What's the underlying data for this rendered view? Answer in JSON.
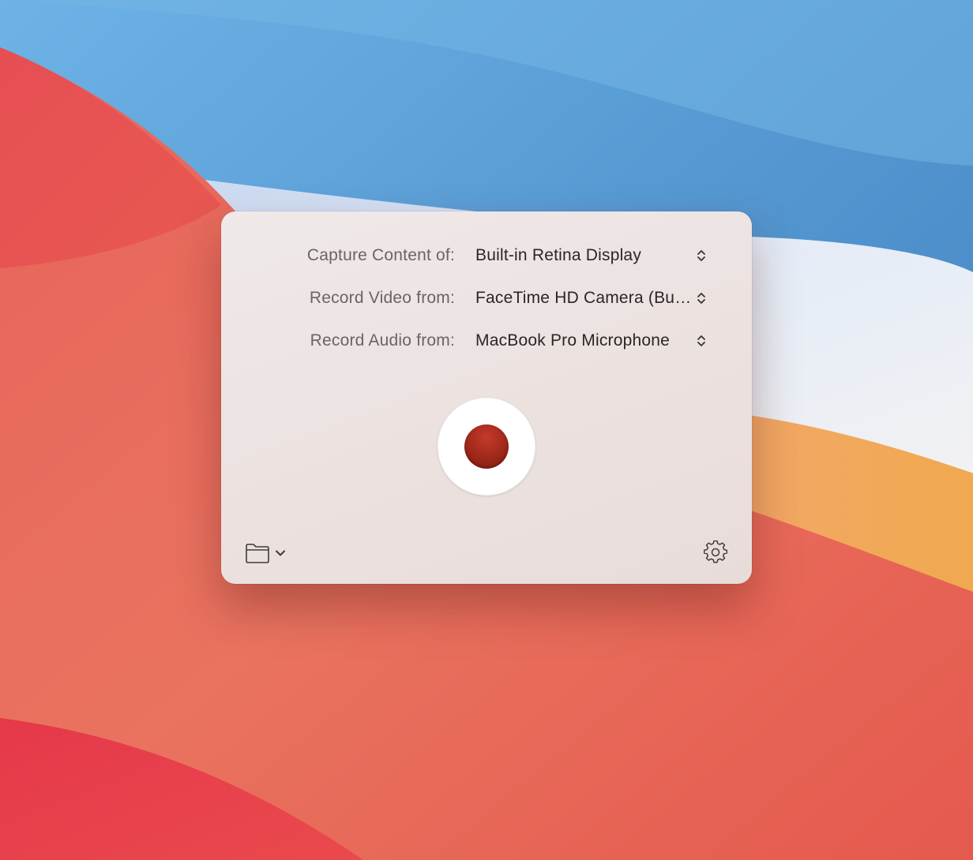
{
  "capture_panel": {
    "rows": [
      {
        "label": "Capture Content of:",
        "value": "Built-in Retina Display"
      },
      {
        "label": "Record Video from:",
        "value": "FaceTime HD Camera (Built-in)"
      },
      {
        "label": "Record Audio from:",
        "value": "MacBook Pro Microphone"
      }
    ],
    "record_button": {
      "icon": "record-dot-icon",
      "color": "#a22b1b"
    },
    "bottom_bar": {
      "left_icons": [
        "folder-icon",
        "chevron-down-icon"
      ],
      "right_icon": "gear-icon"
    }
  },
  "colors": {
    "panel_bg": "#ede6e4",
    "label_text": "#6b6464",
    "value_text": "#2a2626",
    "record_red": "#a22b1b"
  }
}
